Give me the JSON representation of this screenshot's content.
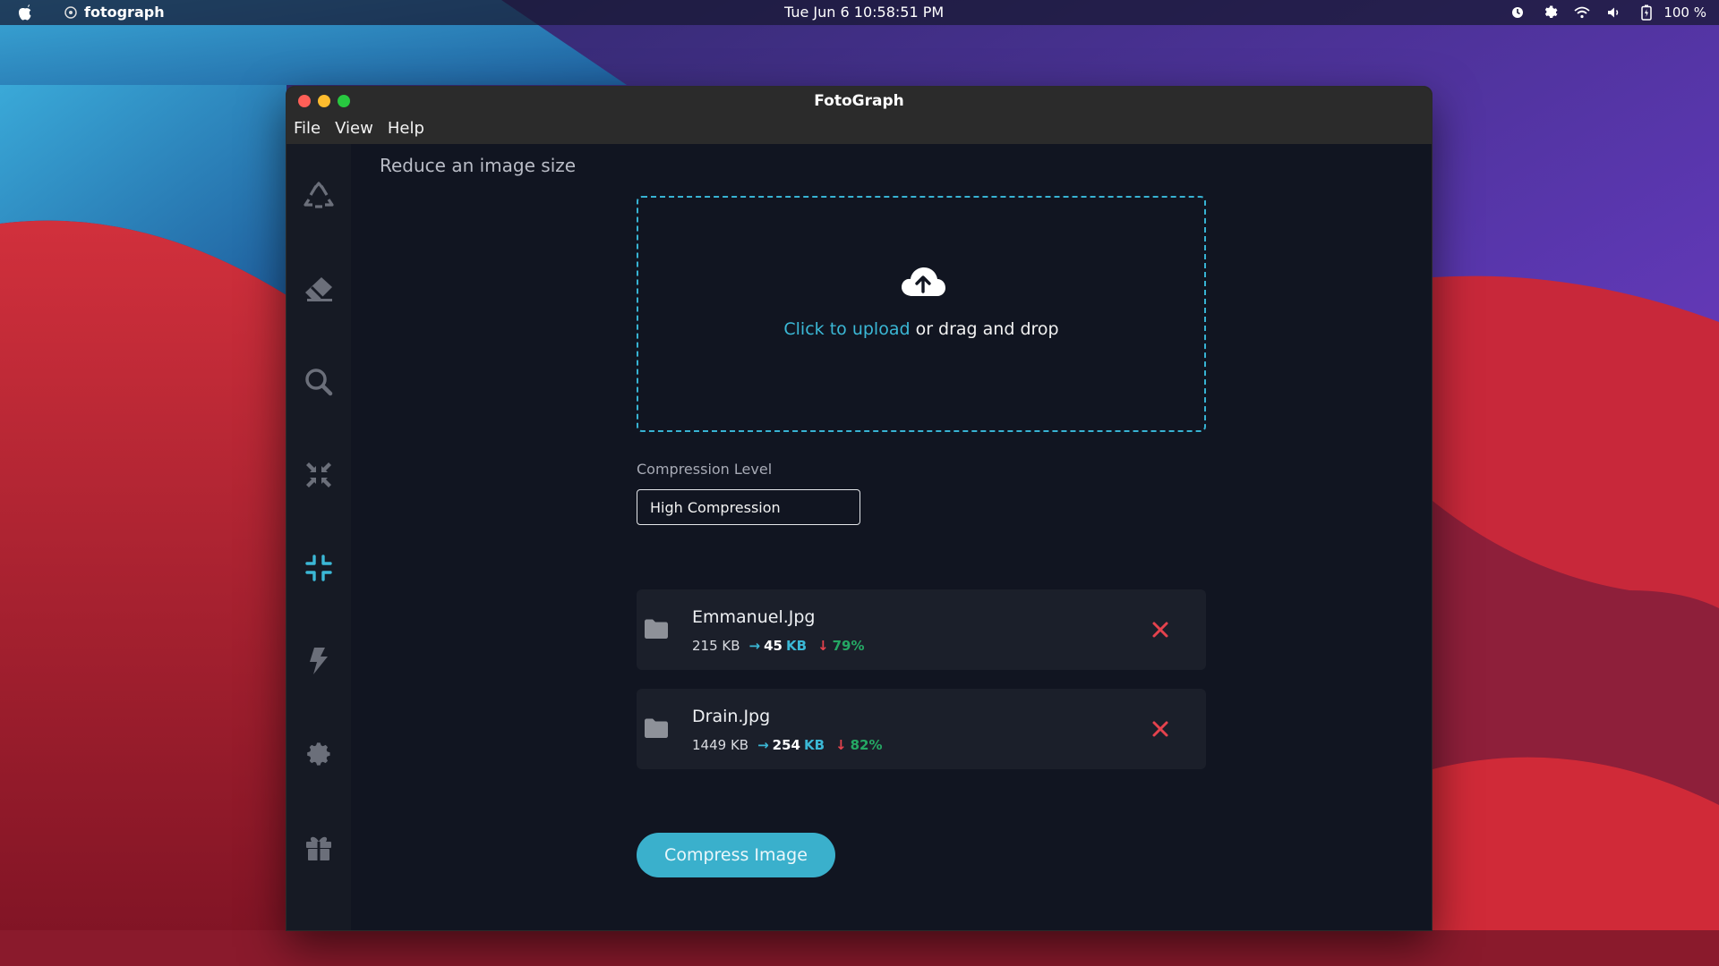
{
  "menubar": {
    "app_name": "fotograph",
    "clock": "Tue Jun 6  10:58:51 PM",
    "battery": "100 %",
    "icons": [
      "apple-icon",
      "app-icon",
      "clock-icon",
      "gear-icon",
      "wifi-icon",
      "volume-icon",
      "battery-icon"
    ]
  },
  "window": {
    "title": "FotoGraph",
    "menu": [
      "File",
      "View",
      "Help"
    ]
  },
  "sidebar": {
    "items": [
      {
        "icon": "recycle-icon",
        "active": false
      },
      {
        "icon": "eraser-icon",
        "active": false
      },
      {
        "icon": "search-icon",
        "active": false
      },
      {
        "icon": "compress-arrows-icon",
        "active": false
      },
      {
        "icon": "compress-icon",
        "active": true
      },
      {
        "icon": "bolt-icon",
        "active": false
      },
      {
        "icon": "gear-icon",
        "active": false
      },
      {
        "icon": "gift-icon",
        "active": false
      }
    ],
    "active_color": "#3bb8d6",
    "inactive_color": "#6b6f7a"
  },
  "main": {
    "heading": "Reduce an image size",
    "upload": {
      "link_text": "Click to upload",
      "rest_text": " or drag and drop"
    },
    "compression": {
      "label": "Compression Level",
      "value": "High Compression"
    },
    "files": [
      {
        "name": "Emmanuel.Jpg",
        "original": "215 KB",
        "new_size": "45",
        "new_unit": "KB",
        "reduction": "79%"
      },
      {
        "name": "Drain.Jpg",
        "original": "1449 KB",
        "new_size": "254",
        "new_unit": "KB",
        "reduction": "82%"
      }
    ],
    "compress_button": "Compress Image"
  },
  "colors": {
    "accent": "#3bb8d6",
    "danger": "#e5424d",
    "success": "#25a864"
  }
}
